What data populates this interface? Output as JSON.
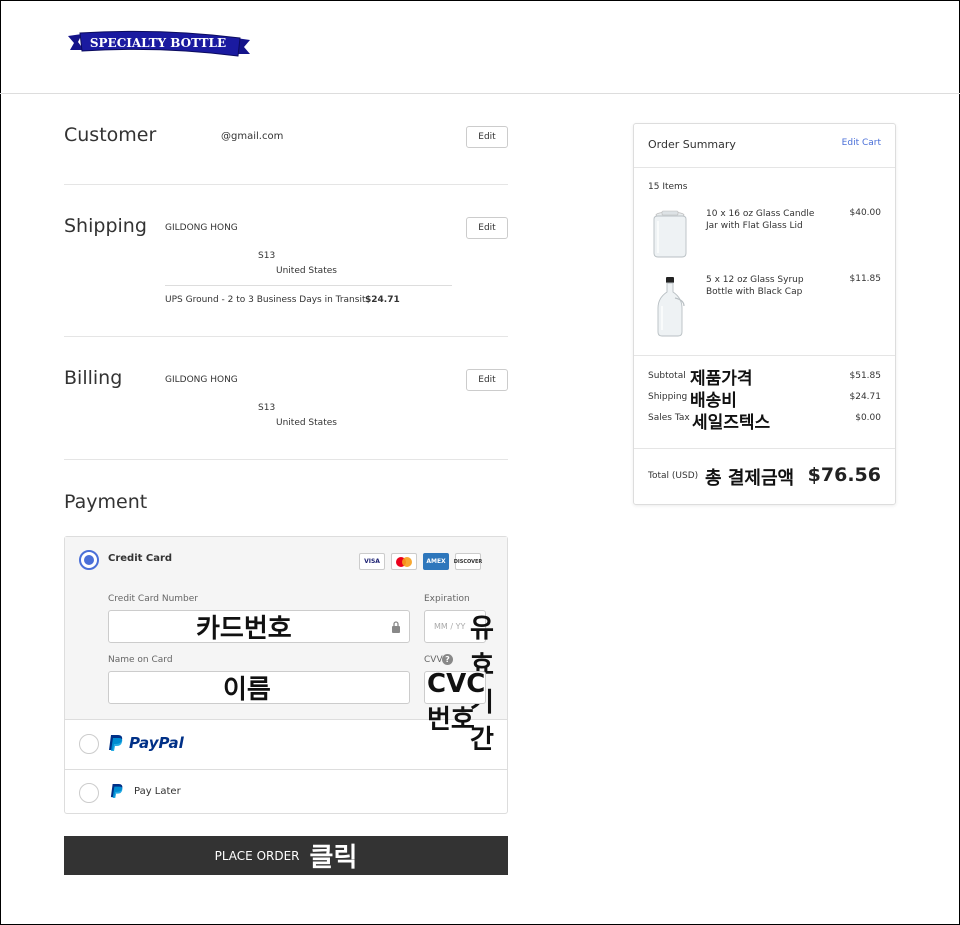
{
  "header": {
    "logo_text": "SPECIALTY BOTTLE"
  },
  "customer": {
    "title": "Customer",
    "email": "@gmail.com",
    "edit_label": "Edit"
  },
  "shipping": {
    "title": "Shipping",
    "name": "GILDONG HONG",
    "address_line": "S13",
    "country": "United States",
    "method": "UPS Ground - 2 to 3 Business Days in Transit",
    "method_price": "$24.71",
    "edit_label": "Edit"
  },
  "billing": {
    "title": "Billing",
    "name": "GILDONG HONG",
    "address_line": "S13",
    "country": "United States",
    "edit_label": "Edit"
  },
  "payment": {
    "title": "Payment",
    "credit_card_label": "Credit Card",
    "card_brands": [
      "VISA",
      "mastercard",
      "AMEX",
      "DISCOVER"
    ],
    "card_number_label": "Credit Card Number",
    "card_number_annotation": "카드번호",
    "expiration_label": "Expiration",
    "expiration_placeholder": "MM / YY",
    "expiration_annotation": "유효기간",
    "name_label": "Name on Card",
    "name_annotation": "이름",
    "cvv_label": "CVV",
    "cvv_annotation": "CVC번호",
    "paypal_label": "PayPal",
    "paylater_label": "Pay Later"
  },
  "place_order": {
    "label": "PLACE ORDER",
    "annotation": "클릭"
  },
  "summary": {
    "title": "Order Summary",
    "edit_cart": "Edit Cart",
    "items_count": "15 Items",
    "items": [
      {
        "name": "10 x 16 oz Glass Candle Jar with Flat Glass Lid",
        "price": "$40.00"
      },
      {
        "name": "5 x 12 oz Glass Syrup Bottle with Black Cap",
        "price": "$11.85"
      }
    ],
    "subtotal_label": "Subtotal",
    "subtotal_annotation": "제품가격",
    "subtotal_value": "$51.85",
    "shipping_label": "Shipping",
    "shipping_annotation": "배송비",
    "shipping_value": "$24.71",
    "tax_label": "Sales Tax",
    "tax_annotation": "세일즈텍스",
    "tax_value": "$0.00",
    "total_label": "Total (USD)",
    "total_annotation": "총 결제금액",
    "total_value": "$76.56"
  }
}
